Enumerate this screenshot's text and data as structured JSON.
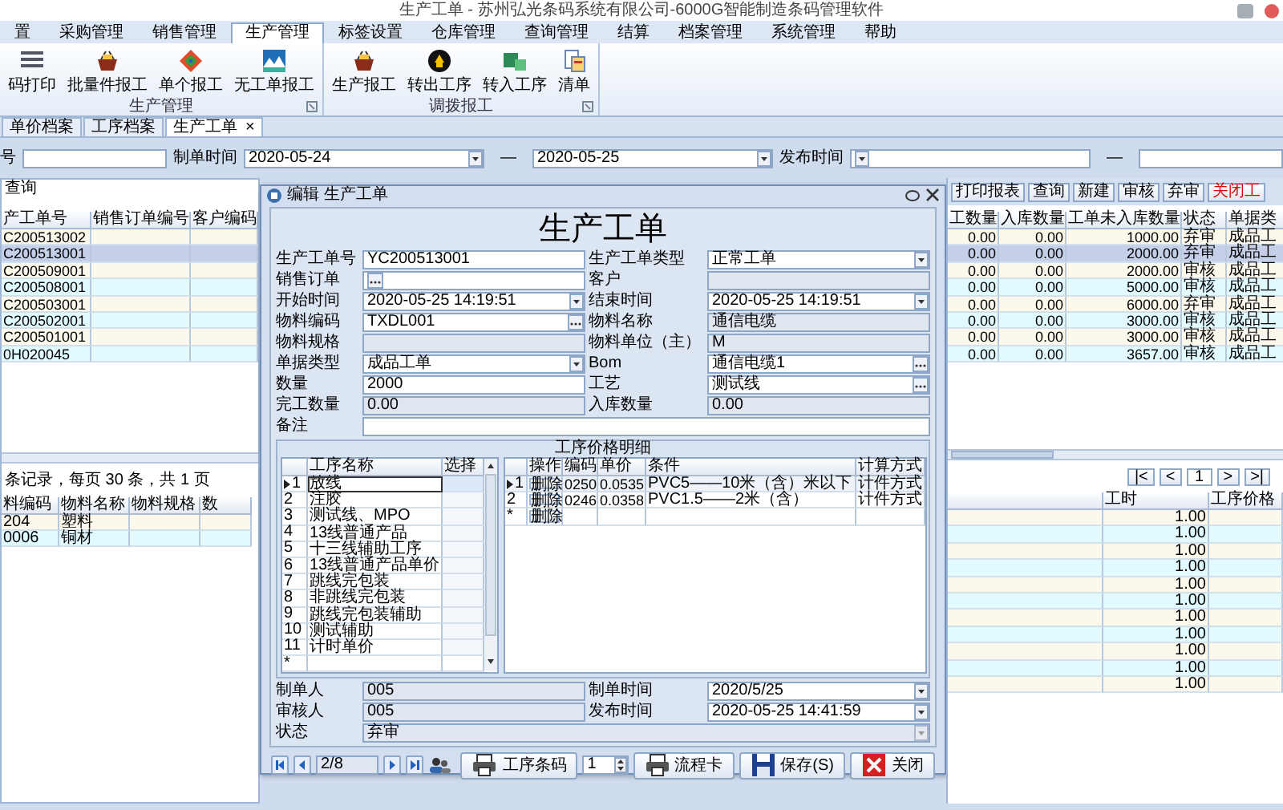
{
  "window": {
    "title": "生产工单 - 苏州弘光条码系统有限公司-6000G智能制造条码管理软件"
  },
  "menu": [
    {
      "label": "置",
      "selected": false
    },
    {
      "label": "采购管理",
      "selected": false
    },
    {
      "label": "销售管理",
      "selected": false
    },
    {
      "label": "生产管理",
      "selected": true
    },
    {
      "label": "标签设置",
      "selected": false
    },
    {
      "label": "仓库管理",
      "selected": false
    },
    {
      "label": "查询管理",
      "selected": false
    },
    {
      "label": "结算",
      "selected": false
    },
    {
      "label": "档案管理",
      "selected": false
    },
    {
      "label": "系统管理",
      "selected": false
    },
    {
      "label": "帮助",
      "selected": false
    }
  ],
  "ribbon": [
    {
      "label": "生产管理",
      "items": [
        "码打印",
        "批量件报工",
        "单个报工",
        "无工单报工"
      ]
    },
    {
      "label": "调拨报工",
      "items": [
        "生产报工",
        "转出工序",
        "转入工序",
        "清单"
      ]
    }
  ],
  "doc_tabs": [
    {
      "label": "单价档案",
      "selected": false
    },
    {
      "label": "工序档案",
      "selected": false
    },
    {
      "label": "生产工单",
      "selected": true,
      "close": "×"
    }
  ],
  "filter": [
    {
      "kind": "label",
      "text": "号"
    },
    {
      "kind": "text"
    },
    {
      "kind": "label",
      "text": "制单时间"
    },
    {
      "kind": "dropdown",
      "value": "2020-05-24"
    },
    {
      "kind": "dash",
      "text": "—"
    },
    {
      "kind": "dropdown",
      "value": "2020-05-25"
    },
    {
      "kind": "label",
      "text": "发布时间"
    },
    {
      "kind": "dropdown"
    },
    {
      "kind": "dash",
      "text": "—"
    },
    {
      "kind": "text"
    }
  ],
  "query_panel": {
    "title": "查询",
    "orders": {
      "columns": [
        "产工单号",
        "销售订单编号",
        "客户编码"
      ],
      "rows": [
        {
          "order_no": "C200513002",
          "selected": false
        },
        {
          "order_no": "C200513001",
          "selected": true
        },
        {
          "order_no": "C200509001",
          "selected": false
        },
        {
          "order_no": "C200508001",
          "selected": false
        },
        {
          "order_no": "C200503001",
          "selected": false
        },
        {
          "order_no": "C200502001",
          "selected": false
        },
        {
          "order_no": "C200501001",
          "selected": false
        },
        {
          "order_no": "0H020045",
          "selected": false
        }
      ]
    },
    "summary": "条记录，每页 30 条，共 1 页",
    "materials": {
      "columns": [
        "料编码",
        "物料名称",
        "物料规格",
        "数"
      ],
      "rows": [
        {
          "code": "204",
          "name": "塑料"
        },
        {
          "code": "0006",
          "name": "铜材"
        }
      ]
    }
  },
  "list_panel": {
    "buttons": [
      {
        "label": "打印报表",
        "kind": "normal"
      },
      {
        "label": "查询",
        "kind": "normal"
      },
      {
        "label": "新建",
        "kind": "normal"
      },
      {
        "label": "审核",
        "kind": "normal"
      },
      {
        "label": "弃审",
        "kind": "normal"
      },
      {
        "label": "关闭工",
        "kind": "danger"
      }
    ],
    "orders": {
      "columns": [
        "工数量",
        "入库数量",
        "工单未入库数量",
        "状态",
        "单据类"
      ],
      "rows": [
        {
          "done": "0.00",
          "stocked": "0.00",
          "pending": "1000.00",
          "status": "弃审",
          "type": "成品工",
          "selected": false
        },
        {
          "done": "0.00",
          "stocked": "0.00",
          "pending": "2000.00",
          "status": "弃审",
          "type": "成品工",
          "selected": true
        },
        {
          "done": "0.00",
          "stocked": "0.00",
          "pending": "2000.00",
          "status": "审核",
          "type": "成品工",
          "selected": false
        },
        {
          "done": "0.00",
          "stocked": "0.00",
          "pending": "5000.00",
          "status": "审核",
          "type": "成品工",
          "selected": false
        },
        {
          "done": "0.00",
          "stocked": "0.00",
          "pending": "6000.00",
          "status": "弃审",
          "type": "成品工",
          "selected": false
        },
        {
          "done": "0.00",
          "stocked": "0.00",
          "pending": "3000.00",
          "status": "审核",
          "type": "成品工",
          "selected": false
        },
        {
          "done": "0.00",
          "stocked": "0.00",
          "pending": "3000.00",
          "status": "审核",
          "type": "成品工",
          "selected": false
        },
        {
          "done": "0.00",
          "stocked": "0.00",
          "pending": "3657.00",
          "status": "审核",
          "type": "成品工",
          "selected": false
        }
      ]
    },
    "pager": [
      {
        "kind": "button",
        "label": "|<"
      },
      {
        "kind": "button",
        "label": "<"
      },
      {
        "kind": "page",
        "label": "1"
      },
      {
        "kind": "button",
        "label": ">"
      },
      {
        "kind": "button",
        "label": ">|"
      }
    ],
    "processes": {
      "columns": [
        "工时",
        "工序价格"
      ],
      "rows": [
        "1.00",
        "1.00",
        "1.00",
        "1.00",
        "1.00",
        "1.00",
        "1.00",
        "1.00",
        "1.00",
        "1.00",
        "1.00"
      ]
    }
  },
  "dialog": {
    "title": "编辑 生产工单",
    "heading": "生产工单",
    "fields": [
      {
        "label": "生产工单号",
        "kind": "text",
        "value": "YC200513001"
      },
      {
        "label": "生产工单类型",
        "kind": "dropdown",
        "value": "正常工单"
      },
      {
        "label": "销售订单",
        "kind": "lookup"
      },
      {
        "label": "客户",
        "kind": "readonly"
      },
      {
        "label": "开始时间",
        "kind": "dropdown",
        "value": "2020-05-25 14:19:51"
      },
      {
        "label": "结束时间",
        "kind": "dropdown",
        "value": "2020-05-25 14:19:51"
      },
      {
        "label": "物料编码",
        "kind": "lookup",
        "value": "TXDL001"
      },
      {
        "label": "物料名称",
        "kind": "readonly",
        "value": "通信电缆"
      },
      {
        "label": "物料规格",
        "kind": "readonly"
      },
      {
        "label": "物料单位（主）",
        "kind": "readonly",
        "value": "M"
      },
      {
        "label": "单据类型",
        "kind": "dropdown",
        "value": "成品工单"
      },
      {
        "label": "Bom",
        "kind": "lookup",
        "value": "通信电缆1"
      },
      {
        "label": "数量",
        "kind": "text",
        "value": "2000"
      },
      {
        "label": "工艺",
        "kind": "lookup",
        "value": "测试线"
      },
      {
        "label": "完工数量",
        "kind": "readonly",
        "value": "0.00"
      },
      {
        "label": "入库数量",
        "kind": "readonly",
        "value": "0.00"
      },
      {
        "label": "备注",
        "kind": "text"
      }
    ],
    "steps": {
      "columns": [
        "工序名称",
        "选择"
      ],
      "rows": [
        {
          "no": "1",
          "name": "放线",
          "selected": true
        },
        {
          "no": "2",
          "name": "注胶",
          "selected": false
        },
        {
          "no": "3",
          "name": "测试线、MPO",
          "selected": false
        },
        {
          "no": "4",
          "name": "13线普通产品",
          "selected": false
        },
        {
          "no": "5",
          "name": "十三线辅助工序",
          "selected": false
        },
        {
          "no": "6",
          "name": "13线普通产品单价",
          "selected": false
        },
        {
          "no": "7",
          "name": "跳线完包装",
          "selected": false
        },
        {
          "no": "8",
          "name": "非跳线完包装",
          "selected": false
        },
        {
          "no": "9",
          "name": "跳线完包装辅助",
          "selected": false
        },
        {
          "no": "10",
          "name": "测试辅助",
          "selected": false
        },
        {
          "no": "11",
          "name": "计时单价",
          "selected": false
        }
      ],
      "new_row": "*"
    },
    "prices": {
      "caption": "工序价格明细",
      "columns": [
        "操作",
        "编码",
        "单价",
        "条件",
        "计算方式"
      ],
      "rows": [
        {
          "no": "1",
          "action": "删除",
          "code": "0250",
          "price": "0.0535",
          "condition": "PVC5——10米（含）米以下",
          "method": "计件方式",
          "selected": true
        },
        {
          "no": "2",
          "action": "删除",
          "code": "0246",
          "price": "0.0358",
          "condition": "PVC1.5——2米（含）",
          "method": "计件方式",
          "selected": false
        }
      ],
      "new_row": {
        "no": "*",
        "action": "删除"
      }
    },
    "footer_fields": [
      {
        "label": "制单人",
        "kind": "readonly",
        "value": "005"
      },
      {
        "label": "制单时间",
        "kind": "dropdown",
        "value": "2020/5/25"
      },
      {
        "label": "审核人",
        "kind": "readonly",
        "value": "005"
      },
      {
        "label": "发布时间",
        "kind": "dropdown",
        "value": "2020-05-25 14:41:59"
      },
      {
        "label": "状态",
        "kind": "locked-dropdown",
        "value": "弃审"
      }
    ],
    "record": "2/8",
    "controls": [
      {
        "kind": "print",
        "label": "工序条码"
      },
      {
        "kind": "spinner",
        "value": "1"
      },
      {
        "kind": "print",
        "label": "流程卡"
      },
      {
        "kind": "save",
        "label": "保存(S)"
      },
      {
        "kind": "close",
        "label": "关闭"
      }
    ]
  }
}
